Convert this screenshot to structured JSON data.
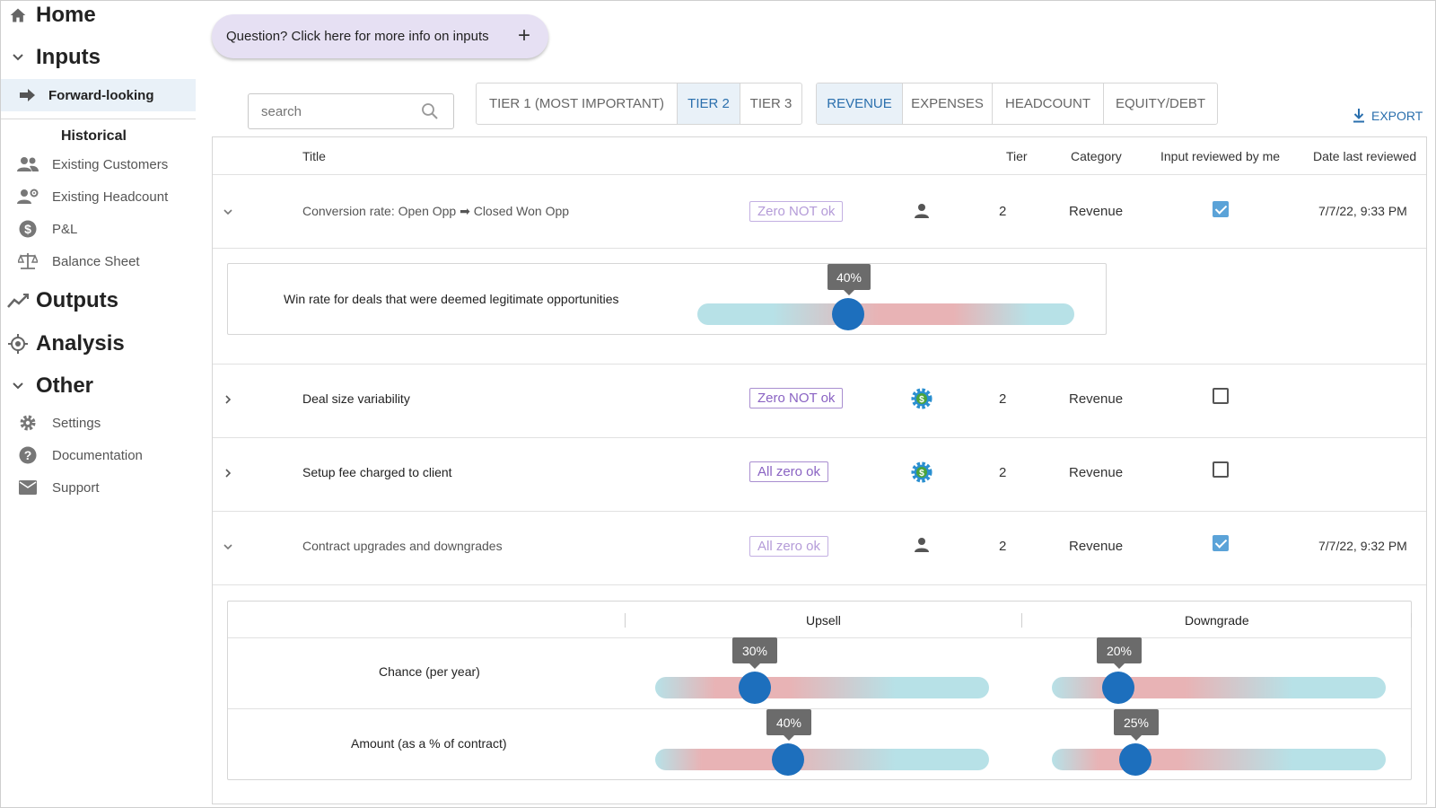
{
  "sidebar": {
    "home": "Home",
    "inputs": "Inputs",
    "forward_looking": "Forward-looking",
    "historical": "Historical",
    "historical_items": [
      "Existing Customers",
      "Existing Headcount",
      "P&L",
      "Balance Sheet"
    ],
    "outputs": "Outputs",
    "analysis": "Analysis",
    "other": "Other",
    "other_items": [
      "Settings",
      "Documentation",
      "Support"
    ]
  },
  "question_label": "Question? Click here for more info on inputs",
  "question_plus": "+",
  "search": {
    "placeholder": "search"
  },
  "tier_tabs": [
    "TIER 1 (MOST IMPORTANT)",
    "TIER 2",
    "TIER 3"
  ],
  "tier_active": "TIER 2",
  "category_tabs": [
    "REVENUE",
    "EXPENSES",
    "HEADCOUNT",
    "EQUITY/DEBT"
  ],
  "category_active": "REVENUE",
  "export_label": "EXPORT",
  "table": {
    "headers": {
      "title": "Title",
      "tier": "Tier",
      "category": "Category",
      "reviewed": "Input reviewed by me",
      "date": "Date last reviewed"
    },
    "rows": [
      {
        "title": "Conversion rate: Open Opp ➡ Closed Won Opp",
        "badge": "Zero NOT ok",
        "owner_icon": "person-icon",
        "tier": "2",
        "category": "Revenue",
        "reviewed": true,
        "date": "7/7/22, 9:33 PM",
        "expanded": true
      },
      {
        "title": "Deal size variability",
        "badge": "Zero NOT ok",
        "owner_icon": "dollar-gear-icon",
        "tier": "2",
        "category": "Revenue",
        "reviewed": false,
        "date": "",
        "expanded": false
      },
      {
        "title": "Setup fee charged to client",
        "badge": "All zero ok",
        "owner_icon": "dollar-gear-icon",
        "tier": "2",
        "category": "Revenue",
        "reviewed": false,
        "date": "",
        "expanded": false
      },
      {
        "title": "Contract upgrades and downgrades",
        "badge": "All zero ok",
        "owner_icon": "person-icon",
        "tier": "2",
        "category": "Revenue",
        "reviewed": true,
        "date": "7/7/22, 9:32 PM",
        "expanded": true
      }
    ],
    "win_rate": {
      "label": "Win rate for deals that were deemed legitimate opportunities",
      "value": "40%",
      "fraction": 0.4
    },
    "contract": {
      "columns": [
        "Upsell",
        "Downgrade"
      ],
      "rows": [
        {
          "label": "Chance (per year)",
          "upsell": "30%",
          "upsell_fraction": 0.3,
          "downgrade": "20%",
          "downgrade_fraction": 0.2
        },
        {
          "label": "Amount (as a % of contract)",
          "upsell": "40%",
          "upsell_fraction": 0.4,
          "downgrade": "25%",
          "downgrade_fraction": 0.25
        }
      ]
    }
  },
  "colors": {
    "accent_blue": "#2a6fad",
    "thumb": "#1d6fbd",
    "badge_purple": "#8a63c3",
    "question_bg": "#e6e0f3",
    "active_tab_bg": "#e9f1f8",
    "track_teal": "#b7e1e7",
    "track_pink": "#e8b3b5"
  }
}
